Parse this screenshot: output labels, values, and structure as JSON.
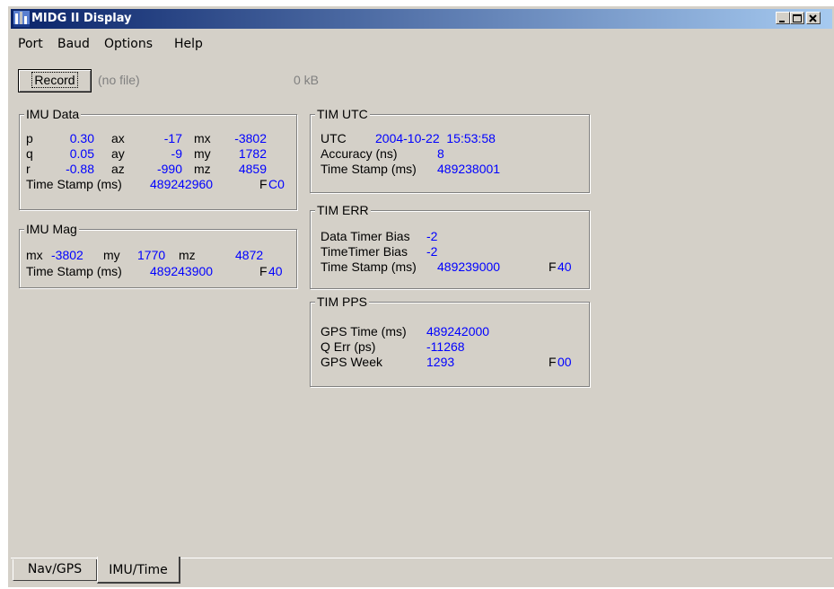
{
  "window": {
    "title": "MIDG II Display"
  },
  "menu": [
    "Port",
    "Baud",
    "Options",
    "Help"
  ],
  "toolbar": {
    "record_label": "Record",
    "file_name": "(no file)",
    "file_size": "0 kB"
  },
  "imu_data": {
    "title": "IMU Data",
    "rows": [
      {
        "l1": "p",
        "v1": "0.30",
        "l2": "ax",
        "v2": "-17",
        "l3": "mx",
        "v3": "-3802"
      },
      {
        "l1": "q",
        "v1": "0.05",
        "l2": "ay",
        "v2": "-9",
        "l3": "my",
        "v3": "1782"
      },
      {
        "l1": "r",
        "v1": "-0.88",
        "l2": "az",
        "v2": "-990",
        "l3": "mz",
        "v3": "4859"
      }
    ],
    "timestamp_label": "Time Stamp (ms)",
    "timestamp": "489242960",
    "flag_label": "F",
    "flag": "C0"
  },
  "imu_mag": {
    "title": "IMU Mag",
    "mx_label": "mx",
    "mx": "-3802",
    "my_label": "my",
    "my": "1770",
    "mz_label": "mz",
    "mz": "4872",
    "timestamp_label": "Time Stamp (ms)",
    "timestamp": "489243900",
    "flag_label": "F",
    "flag": "40"
  },
  "tim_utc": {
    "title": "TIM UTC",
    "utc_label": "UTC",
    "utc": "2004-10-22  15:53:58",
    "accuracy_label": "Accuracy (ns)",
    "accuracy": "8",
    "timestamp_label": "Time Stamp (ms)",
    "timestamp": "489238001"
  },
  "tim_err": {
    "title": "TIM ERR",
    "data_bias_label": "Data Timer Bias",
    "data_bias": "-2",
    "time_bias_label": "TimeTimer Bias",
    "time_bias": "-2",
    "timestamp_label": "Time Stamp (ms)",
    "timestamp": "489239000",
    "flag_label": "F",
    "flag": "40"
  },
  "tim_pps": {
    "title": "TIM PPS",
    "gps_time_label": "GPS Time (ms)",
    "gps_time": "489242000",
    "q_err_label": "Q Err (ps)",
    "q_err": "-11268",
    "gps_week_label": "GPS Week",
    "gps_week": "1293",
    "flag_label": "F",
    "flag": "00"
  },
  "tabs": [
    {
      "label": "Nav/GPS"
    },
    {
      "label": "IMU/Time",
      "active": true
    }
  ]
}
